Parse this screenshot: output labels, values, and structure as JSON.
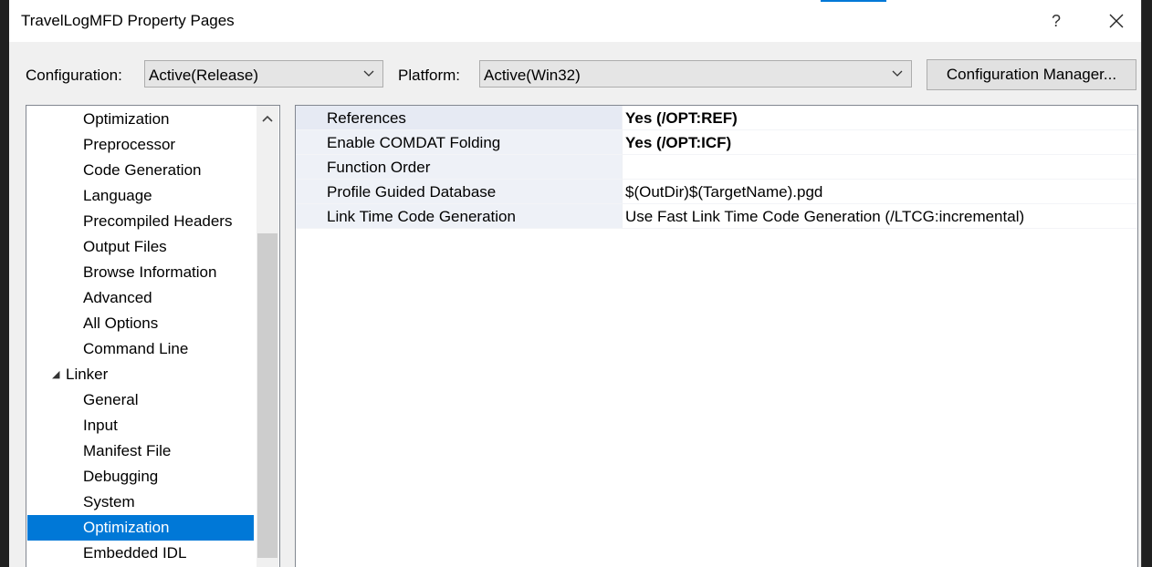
{
  "window": {
    "title": "TravelLogMFD Property Pages",
    "help_glyph": "?"
  },
  "toolbar": {
    "configuration_label": "Configuration:",
    "configuration_value": "Active(Release)",
    "platform_label": "Platform:",
    "platform_value": "Active(Win32)",
    "config_manager_label": "Configuration Manager..."
  },
  "tree": {
    "items": [
      {
        "label": "Optimization",
        "level": 2
      },
      {
        "label": "Preprocessor",
        "level": 2
      },
      {
        "label": "Code Generation",
        "level": 2
      },
      {
        "label": "Language",
        "level": 2
      },
      {
        "label": "Precompiled Headers",
        "level": 2
      },
      {
        "label": "Output Files",
        "level": 2
      },
      {
        "label": "Browse Information",
        "level": 2
      },
      {
        "label": "Advanced",
        "level": 2
      },
      {
        "label": "All Options",
        "level": 2
      },
      {
        "label": "Command Line",
        "level": 2
      },
      {
        "label": "Linker",
        "level": 1,
        "expanded": true
      },
      {
        "label": "General",
        "level": 2
      },
      {
        "label": "Input",
        "level": 2
      },
      {
        "label": "Manifest File",
        "level": 2
      },
      {
        "label": "Debugging",
        "level": 2
      },
      {
        "label": "System",
        "level": 2
      },
      {
        "label": "Optimization",
        "level": 2,
        "selected": true
      },
      {
        "label": "Embedded IDL",
        "level": 2
      }
    ]
  },
  "properties": [
    {
      "name": "References",
      "value": "Yes (/OPT:REF)",
      "bold": true
    },
    {
      "name": "Enable COMDAT Folding",
      "value": "Yes (/OPT:ICF)",
      "bold": true
    },
    {
      "name": "Function Order",
      "value": "",
      "bold": false
    },
    {
      "name": "Profile Guided Database",
      "value": "$(OutDir)$(TargetName).pgd",
      "bold": false
    },
    {
      "name": "Link Time Code Generation",
      "value": "Use Fast Link Time Code Generation (/LTCG:incremental)",
      "bold": false
    }
  ],
  "colors": {
    "selection": "#0078d7",
    "dialog_bg": "#f0f0f0",
    "property_name_bg": "#eef1f7"
  }
}
